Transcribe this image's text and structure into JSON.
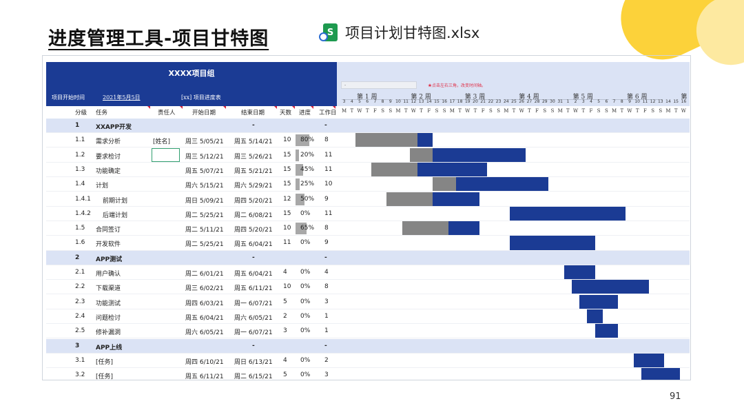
{
  "slide": {
    "title": "进度管理工具-项目甘特图",
    "file_name": "项目计划甘特图.xlsx",
    "file_icon": "spreadsheet-sync-icon",
    "file_icon_letter": "S",
    "page_number": "91"
  },
  "sheet": {
    "group_name": "XXXX项目组",
    "start_label": "项目开始时间",
    "start_value": "2021年5月5日",
    "progress_table_label": "[xx] 项目进度表",
    "input_placeholder": "-",
    "note": "★点击左右三角，改变时间轴。",
    "weeks": [
      "第 1 周",
      "第 2 周",
      "第 3 周",
      "第 4 周",
      "第 5 周",
      "第 6 周",
      "第"
    ],
    "day_numbers": [
      "3",
      "4",
      "5",
      "6",
      "7",
      "8",
      "9",
      "10",
      "11",
      "12",
      "13",
      "14",
      "15",
      "16",
      "17",
      "18",
      "19",
      "20",
      "21",
      "22",
      "23",
      "24",
      "25",
      "26",
      "27",
      "28",
      "29",
      "30",
      "31",
      "1",
      "2",
      "3",
      "4",
      "5",
      "6",
      "7",
      "8",
      "9",
      "10",
      "11",
      "12",
      "13",
      "14",
      "15",
      "16"
    ],
    "day_letters": [
      "M",
      "T",
      "W",
      "T",
      "F",
      "S",
      "S",
      "M",
      "T",
      "W",
      "T",
      "F",
      "S",
      "S",
      "M",
      "T",
      "W",
      "T",
      "F",
      "S",
      "S",
      "M",
      "T",
      "W",
      "T",
      "F",
      "S",
      "S",
      "M",
      "T",
      "W",
      "T",
      "F",
      "S",
      "S",
      "M",
      "T",
      "W",
      "T",
      "F",
      "S",
      "S",
      "M",
      "T",
      "W"
    ],
    "columns": {
      "id": "分级",
      "task": "任务",
      "owner": "责任人",
      "start": "开始日期",
      "end": "结束日期",
      "days": "天数",
      "progress": "进度",
      "workdays": "工作日"
    },
    "rows": [
      {
        "type": "section",
        "id": "1",
        "task": "XXAPP开发",
        "start": "-",
        "end": "",
        "days": "",
        "progress_text": "",
        "workdays": "-"
      },
      {
        "type": "task",
        "id": "1.1",
        "task": "需求分析",
        "owner": "[姓名]",
        "start": "周三 5/05/21",
        "end": "周五 5/14/21",
        "days": "10",
        "progress": 0.8,
        "progress_text": "80%",
        "workdays": "8",
        "gantt_start": 2,
        "gantt_done": 8,
        "gantt_total": 10
      },
      {
        "type": "task",
        "id": "1.2",
        "task": "要求检讨",
        "owner": "",
        "start": "周三 5/12/21",
        "end": "周三 5/26/21",
        "days": "15",
        "progress": 0.2,
        "progress_text": "20%",
        "workdays": "11",
        "gantt_start": 9,
        "gantt_done": 3,
        "gantt_total": 15
      },
      {
        "type": "task",
        "id": "1.3",
        "task": "功能确定",
        "owner": "",
        "start": "周五 5/07/21",
        "end": "周五 5/21/21",
        "days": "15",
        "progress": 0.45,
        "progress_text": "45%",
        "workdays": "11",
        "gantt_start": 4,
        "gantt_done": 6,
        "gantt_total": 15
      },
      {
        "type": "task",
        "id": "1.4",
        "task": "计划",
        "owner": "",
        "start": "周六 5/15/21",
        "end": "周六 5/29/21",
        "days": "15",
        "progress": 0.25,
        "progress_text": "25%",
        "workdays": "10",
        "gantt_start": 12,
        "gantt_done": 3,
        "gantt_total": 15
      },
      {
        "type": "task",
        "id": "1.4.1",
        "task": "前期计划",
        "indent": true,
        "owner": "",
        "start": "周日 5/09/21",
        "end": "周四 5/20/21",
        "days": "12",
        "progress": 0.5,
        "progress_text": "50%",
        "workdays": "9",
        "gantt_start": 6,
        "gantt_done": 6,
        "gantt_total": 12
      },
      {
        "type": "task",
        "id": "1.4.2",
        "task": "后端计划",
        "indent": true,
        "owner": "",
        "start": "周二 5/25/21",
        "end": "周二 6/08/21",
        "days": "15",
        "progress": 0,
        "progress_text": "0%",
        "workdays": "11",
        "gantt_start": 22,
        "gantt_done": 0,
        "gantt_total": 15
      },
      {
        "type": "task",
        "id": "1.5",
        "task": "合同签订",
        "owner": "",
        "start": "周二 5/11/21",
        "end": "周四 5/20/21",
        "days": "10",
        "progress": 0.65,
        "progress_text": "65%",
        "workdays": "8",
        "gantt_start": 8,
        "gantt_done": 6,
        "gantt_total": 10
      },
      {
        "type": "task",
        "id": "1.6",
        "task": "开发软件",
        "owner": "",
        "start": "周二 5/25/21",
        "end": "周五 6/04/21",
        "days": "11",
        "progress": 0,
        "progress_text": "0%",
        "workdays": "9",
        "gantt_start": 22,
        "gantt_done": 0,
        "gantt_total": 11
      },
      {
        "type": "section",
        "id": "2",
        "task": "APP测试",
        "start": "-",
        "end": "",
        "days": "",
        "progress_text": "",
        "workdays": "-"
      },
      {
        "type": "task",
        "id": "2.1",
        "task": "用户确认",
        "owner": "",
        "start": "周二 6/01/21",
        "end": "周五 6/04/21",
        "days": "4",
        "progress": 0,
        "progress_text": "0%",
        "workdays": "4",
        "gantt_start": 29,
        "gantt_done": 0,
        "gantt_total": 4
      },
      {
        "type": "task",
        "id": "2.2",
        "task": "下载渠道",
        "owner": "",
        "start": "周三 6/02/21",
        "end": "周五 6/11/21",
        "days": "10",
        "progress": 0,
        "progress_text": "0%",
        "workdays": "8",
        "gantt_start": 30,
        "gantt_done": 0,
        "gantt_total": 10
      },
      {
        "type": "task",
        "id": "2.3",
        "task": "功能测试",
        "owner": "",
        "start": "周四 6/03/21",
        "end": "周一 6/07/21",
        "days": "5",
        "progress": 0,
        "progress_text": "0%",
        "workdays": "3",
        "gantt_start": 31,
        "gantt_done": 0,
        "gantt_total": 5
      },
      {
        "type": "task",
        "id": "2.4",
        "task": "问题检讨",
        "owner": "",
        "start": "周五 6/04/21",
        "end": "周六 6/05/21",
        "days": "2",
        "progress": 0,
        "progress_text": "0%",
        "workdays": "1",
        "gantt_start": 32,
        "gantt_done": 0,
        "gantt_total": 2
      },
      {
        "type": "task",
        "id": "2.5",
        "task": "修补漏洞",
        "owner": "",
        "start": "周六 6/05/21",
        "end": "周一 6/07/21",
        "days": "3",
        "progress": 0,
        "progress_text": "0%",
        "workdays": "1",
        "gantt_start": 33,
        "gantt_done": 0,
        "gantt_total": 3
      },
      {
        "type": "section",
        "id": "3",
        "task": "APP上线",
        "start": "-",
        "end": "",
        "days": "",
        "progress_text": "",
        "workdays": "-"
      },
      {
        "type": "task",
        "id": "3.1",
        "task": "[任务]",
        "owner": "",
        "start": "周四 6/10/21",
        "end": "周日 6/13/21",
        "days": "4",
        "progress": 0,
        "progress_text": "0%",
        "workdays": "2",
        "gantt_start": 38,
        "gantt_done": 0,
        "gantt_total": 4
      },
      {
        "type": "task",
        "id": "3.2",
        "task": "[任务]",
        "owner": "",
        "start": "周五 6/11/21",
        "end": "周二 6/15/21",
        "days": "5",
        "progress": 0,
        "progress_text": "0%",
        "workdays": "3",
        "gantt_start": 39,
        "gantt_done": 0,
        "gantt_total": 5
      }
    ]
  },
  "colors": {
    "header_blue": "#1b3b94",
    "section_fill": "#dbe3f5",
    "done_gray": "#858585",
    "accent_yellow": "#fcd23a"
  }
}
